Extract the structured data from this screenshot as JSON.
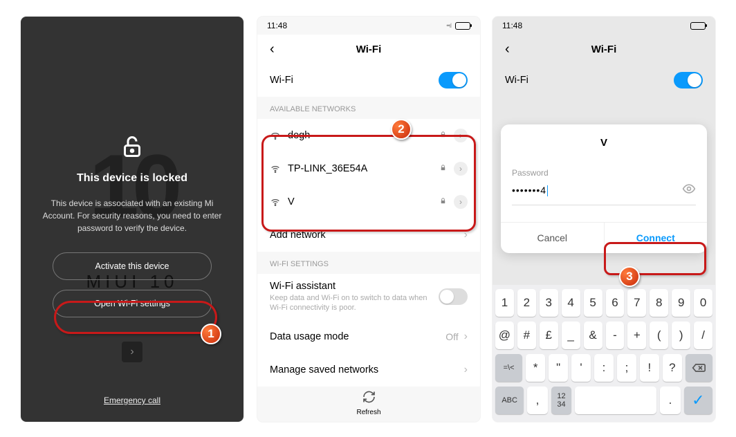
{
  "screen1": {
    "bg_text": "10",
    "miui_text": "MIUI 10",
    "title": "This device is locked",
    "description": "This device is associated with an existing Mi Account. For security reasons, you need to enter password to verify the device.",
    "activate_btn": "Activate this device",
    "wifi_btn": "Open Wi-Fi settings",
    "emergency": "Emergency call"
  },
  "screen2": {
    "time": "11:48",
    "header": "Wi-Fi",
    "wifi_label": "Wi-Fi",
    "available_label": "AVAILABLE NETWORKS",
    "networks": [
      {
        "name": "degh"
      },
      {
        "name": "TP-LINK_36E54A"
      },
      {
        "name": "V"
      }
    ],
    "add_network": "Add network",
    "settings_label": "WI-FI SETTINGS",
    "assistant_title": "Wi-Fi assistant",
    "assistant_sub": "Keep data and Wi-Fi on to switch to data when Wi-Fi connectivity is poor.",
    "data_usage": "Data usage mode",
    "data_usage_val": "Off",
    "manage_saved": "Manage saved networks",
    "refresh": "Refresh"
  },
  "screen3": {
    "time": "11:48",
    "header": "Wi-Fi",
    "wifi_label": "Wi-Fi",
    "modal_title": "V",
    "password_label": "Password",
    "password_value": "•••••••4",
    "cancel": "Cancel",
    "connect": "Connect",
    "kbd_row1": [
      "1",
      "2",
      "3",
      "4",
      "5",
      "6",
      "7",
      "8",
      "9",
      "0"
    ],
    "kbd_row2": [
      "@",
      "#",
      "£",
      "_",
      "&",
      "-",
      "+",
      "(",
      ")",
      "/"
    ],
    "kbd_row3_shift": "=\\<",
    "kbd_row3": [
      "*",
      "\"",
      "'",
      ":",
      ";",
      "!",
      "?"
    ],
    "kbd_abc": "ABC",
    "kbd_comma": ",",
    "kbd_lang_top": "12",
    "kbd_lang_bot": "34",
    "kbd_dot": "."
  },
  "badges": {
    "b1": "1",
    "b2": "2",
    "b3": "3"
  }
}
